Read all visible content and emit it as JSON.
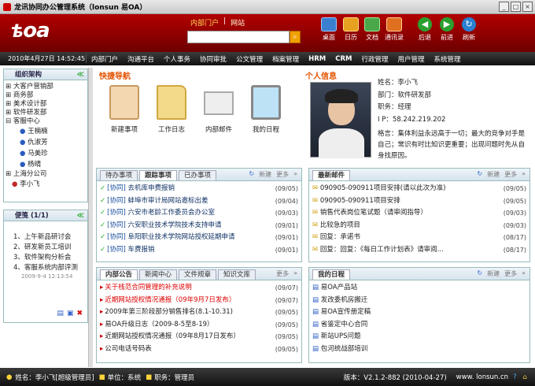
{
  "window": {
    "title": "龙讯协同办公管理系统（lonsun 易OA）"
  },
  "header": {
    "logo": "oa",
    "search_tabs": [
      "内部门户",
      "网站"
    ],
    "icons": [
      {
        "label": "桌面",
        "name": "desktop-icon",
        "color": "#3a7fd0"
      },
      {
        "label": "日历",
        "name": "calendar-icon",
        "color": "#e8a020"
      },
      {
        "label": "文档",
        "name": "document-icon",
        "color": "#4aa84a"
      },
      {
        "label": "通讯录",
        "name": "contacts-icon",
        "color": "#e07020"
      },
      {
        "label": "后退",
        "name": "back-icon",
        "color": "#2aa030"
      },
      {
        "label": "前进",
        "name": "forward-icon",
        "color": "#2aa030"
      },
      {
        "label": "刷新",
        "name": "refresh-icon",
        "color": "#2a80d0"
      }
    ]
  },
  "menubar": {
    "datetime": "2010年4月27日 14:52:45",
    "items": [
      "内部门户",
      "沟通平台",
      "个人事务",
      "协同审批",
      "公文管理",
      "档案管理",
      "HRM",
      "CRM",
      "行政管理",
      "用户管理",
      "系统管理"
    ]
  },
  "sidebar": {
    "title": "组织架构",
    "nodes": [
      "大客户营销部",
      "商务部",
      "美术设计部",
      "软件研发部",
      "客服中心",
      "王楠楠",
      "仇淑芳",
      "马美珍",
      "杨晴",
      "上海分公司",
      "李小飞"
    ]
  },
  "memo": {
    "title": "便笺 (1/1)",
    "items": [
      "1、上午新品研讨会",
      "2、研发新员工培训",
      "3、软件架构分析会",
      "4、客服系统内部评测"
    ],
    "timestamp": "2009-9-4 12:13:54"
  },
  "quicknav": {
    "title": "快捷导航",
    "items": [
      "新建事项",
      "工作日志",
      "内部邮件",
      "我的日程"
    ]
  },
  "profile": {
    "title": "个人信息",
    "name": "姓名：李小飞",
    "dept": "部门：软件研发部",
    "role": "职务：经理",
    "ip": "I P：58.242.219.202",
    "motto_label": "格言：",
    "motto": "集体利益永远高于一切；最大的竞争对手是自己；常识有时比知识更重要；出现问题时先从自身找原因。"
  },
  "todo": {
    "tabs": [
      "待办事项",
      "跟踪事项",
      "已办事项"
    ],
    "tools": [
      "新建",
      "更多"
    ],
    "rows": [
      {
        "tag": "[协同]",
        "text": "去机库申费报销",
        "date": "(09/05)"
      },
      {
        "tag": "[协同]",
        "text": "蚌埠市审计局网站邀标出差",
        "date": "(09/04)"
      },
      {
        "tag": "[协同]",
        "text": "六安市老龄工作委员会办公室",
        "date": "(09/03)"
      },
      {
        "tag": "[协同]",
        "text": "六安职业技术学院技术支持申请",
        "date": "(09/01)"
      },
      {
        "tag": "[协同]",
        "text": "阜阳职业技术学院网站授权延期申请",
        "date": "(09/01)"
      },
      {
        "tag": "[协同]",
        "text": "车费报销",
        "date": "(09/01)"
      }
    ]
  },
  "mail": {
    "tabs": [
      "最新邮件"
    ],
    "tools": [
      "新建",
      "更多"
    ],
    "rows": [
      {
        "text": "090905-090911项目安排(请以此次为准)",
        "date": "(09/05)"
      },
      {
        "text": "090905-090911项目安排",
        "date": "(09/05)"
      },
      {
        "text": "销售代表岗位笔试题（请审阅指导）",
        "date": "(09/03)"
      },
      {
        "text": "比较急的项目",
        "date": "(09/03)"
      },
      {
        "text": "回复：承诺书",
        "date": "(08/17)"
      },
      {
        "text": "回复：回复：《每日工作计划表》请审阅...",
        "date": "(08/17)"
      }
    ]
  },
  "notice": {
    "tabs": [
      "内部公告",
      "新闻中心",
      "文件规章",
      "知识文库"
    ],
    "tools": [
      "更多"
    ],
    "rows": [
      {
        "text": "关于栈范合同管理的补充说明",
        "date": "(09/07)",
        "red": true
      },
      {
        "text": "近期网站授权情况通报（09年9月7日发布）",
        "date": "(09/07)",
        "red": true
      },
      {
        "text": "2009年第三阶段部分销售排名(8.1-10.31)",
        "date": "(09/05)",
        "red": false
      },
      {
        "text": "易OA升级日志（2009-8-5至8-19）",
        "date": "(09/05)",
        "red": false
      },
      {
        "text": "近期网站授权情况通报（09年8月17日发布）",
        "date": "(09/05)",
        "red": false
      },
      {
        "text": "公司电话号码表",
        "date": "(09/05)",
        "red": false
      }
    ]
  },
  "schedule": {
    "tabs": [
      "我的日程"
    ],
    "tools": [
      "新建",
      "更多"
    ],
    "rows": [
      "易OA产品站",
      "发改委机房搬迁",
      "易OA宣传册定稿",
      "省鉴定中心合同",
      "新站UPS问题",
      "包河统战部培训"
    ]
  },
  "footer": {
    "user": "姓名：李小飞[超级管理员]",
    "unit": "单位：系统",
    "role": "职务：管理员",
    "version": "版本：V2.1.2-882 (2010-04-27)",
    "site": "www. lonsun.cn"
  }
}
